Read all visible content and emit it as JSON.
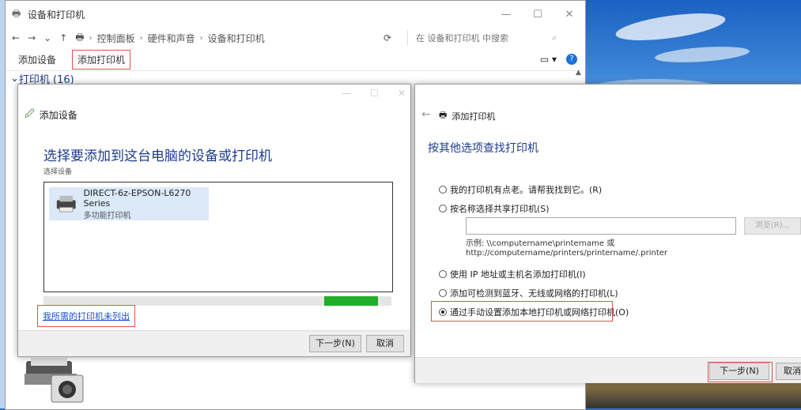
{
  "explorer": {
    "title": "设备和打印机",
    "nav": {
      "back": "←",
      "forward": "→",
      "dropdown": "⌄",
      "up": "↑"
    },
    "breadcrumb": [
      "控制面板",
      "硬件和声音",
      "设备和打印机"
    ],
    "search_placeholder": "在 设备和打印机 中搜索",
    "toolbar": {
      "add_device": "添加设备",
      "add_printer": "添加打印机"
    },
    "group_label": "打印机 (16)",
    "window_controls": [
      "—",
      "☐",
      "✕"
    ]
  },
  "add_device_dialog": {
    "header": "添加设备",
    "heading": "选择要添加到这台电脑的设备或打印机",
    "subheading": "选择设备",
    "device": {
      "name": "DIRECT-6z-EPSON-L6270 Series",
      "type": "多功能打印机"
    },
    "progress": 0.17,
    "not_listed_link": "我所需的打印机未列出",
    "next_button": "下一步(N)",
    "cancel_button": "取消"
  },
  "add_printer_dialog": {
    "header": "添加打印机",
    "heading": "按其他选项查找打印机",
    "options": [
      {
        "label": "我的打印机有点老。请帮我找到它。(R)",
        "selected": false
      },
      {
        "label": "按名称选择共享打印机(S)",
        "selected": false
      },
      {
        "label": "使用 IP 地址或主机名添加打印机(I)",
        "selected": false
      },
      {
        "label": "添加可检测到蓝牙、无线或网络的打印机(L)",
        "selected": false
      },
      {
        "label": "通过手动设置添加本地打印机或网络打印机(O)",
        "selected": true
      }
    ],
    "browse_button": "浏览(R)...",
    "example_line1": "示例: \\\\computername\\printername 或",
    "example_line2": "http://computername/printers/printername/.printer",
    "next_button": "下一步(N)",
    "cancel_button": "取消"
  },
  "colors": {
    "highlight": "#e05050",
    "link": "#1a4fcf",
    "title_blue": "#1d3b8f",
    "progress": "#1fae2a"
  }
}
